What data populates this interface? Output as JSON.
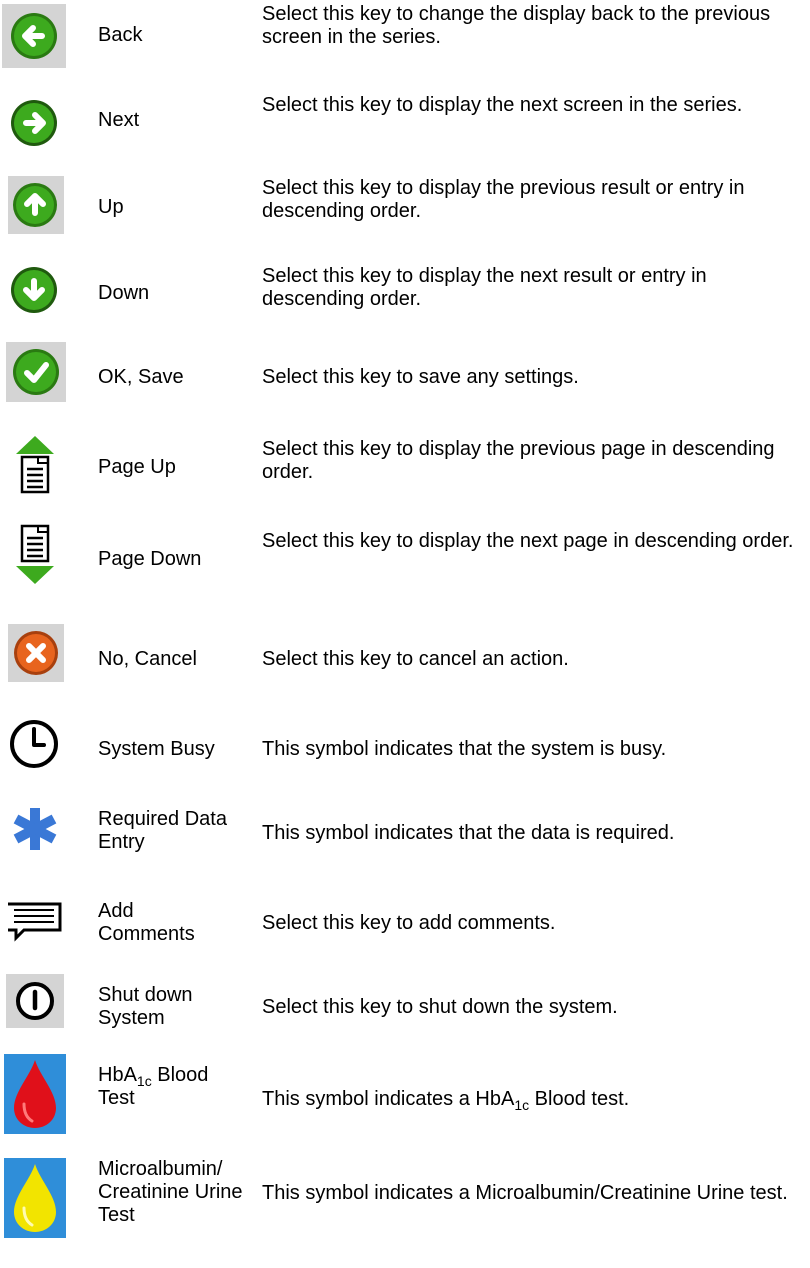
{
  "rows": [
    {
      "icon": "back-arrow-icon",
      "name": "Back",
      "desc": "Select this key to change the display back to the previous screen in the series."
    },
    {
      "icon": "next-arrow-icon",
      "name": "Next",
      "desc": "Select this key to display the next screen in the series."
    },
    {
      "icon": "up-arrow-icon",
      "name": "Up",
      "desc": "Select this key to display the previous result or entry in descending order."
    },
    {
      "icon": "down-arrow-icon",
      "name": "Down",
      "desc": "Select this key to display the next result or entry in descending order."
    },
    {
      "icon": "checkmark-icon",
      "name": "OK, Save",
      "desc": "Select this key to save any settings."
    },
    {
      "icon": "page-up-icon",
      "name": "Page Up",
      "desc": "Select this key to display the previous page in descending order."
    },
    {
      "icon": "page-down-icon",
      "name": "Page Down",
      "desc": "Select this key to display the next page in descending order."
    },
    {
      "icon": "cancel-x-icon",
      "name": "No, Cancel",
      "desc": "Select this key to cancel an action."
    },
    {
      "icon": "clock-icon",
      "name": "System Busy",
      "desc": "This symbol indicates that the system is busy."
    },
    {
      "icon": "asterisk-icon",
      "name": "Required Data Entry",
      "desc": "This symbol indicates that the data is required."
    },
    {
      "icon": "comment-icon",
      "name": "Add Comments",
      "desc": "Select this key to add comments."
    },
    {
      "icon": "power-icon",
      "name": "Shut down System",
      "desc": "Select this key to shut down the system."
    },
    {
      "icon": "blood-drop-icon",
      "name_parts": [
        "HbA",
        "1c",
        " Blood Test"
      ],
      "desc_parts": [
        "This symbol indicates a HbA",
        "1c",
        " Blood test."
      ]
    },
    {
      "icon": "urine-drop-icon",
      "name": "Microalbumin/ Creatinine Urine Test",
      "desc": "This symbol indicates a Microalbumin/Creatinine Urine test."
    }
  ],
  "colors": {
    "green": "#3daa1e",
    "orange": "#e8641e",
    "blue": "#3a78d6",
    "red": "#e0101a",
    "yellow": "#f2e400",
    "icon_bg": "#d4d4d4",
    "drop_bg": "#2f8ed9"
  }
}
